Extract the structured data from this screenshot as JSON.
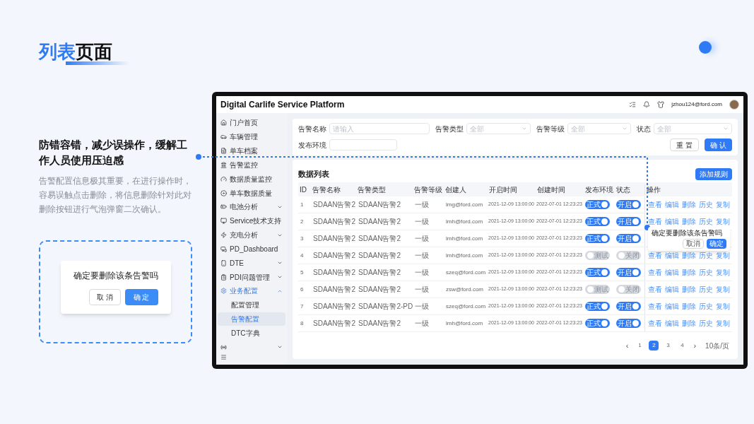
{
  "slide": {
    "title_accent": "列表",
    "title_rest": "页面",
    "heading": "防错容错，减少误操作，缓解工作人员使用压迫感",
    "paragraph": "告警配置信息极其重要，在进行操作时，容易误触点击删除，将信息删除针对此对删除按钮进行气泡弹窗二次确认。",
    "example": {
      "question": "确定要删除该条告警吗",
      "cancel": "取 消",
      "confirm": "确 定"
    }
  },
  "app": {
    "title": "Digital Carlife Service Platform",
    "user": "jzhou124@ford.com",
    "sidebar": [
      {
        "label": "门户首页",
        "selected": false
      },
      {
        "label": "车辆管理",
        "selected": false
      },
      {
        "label": "单车档案",
        "selected": false
      },
      {
        "label": "告警监控",
        "selected": false
      },
      {
        "label": "数据质量监控",
        "selected": false
      },
      {
        "label": "单车数据质量",
        "selected": false
      },
      {
        "label": "电池分析",
        "selected": false,
        "expanded": false
      },
      {
        "label": "Service技术支持",
        "selected": false,
        "expanded": false
      },
      {
        "label": "充电分析",
        "selected": false,
        "expanded": false
      },
      {
        "label": "PD_Dashboard",
        "selected": false
      },
      {
        "label": "DTE",
        "selected": false,
        "expanded": false
      },
      {
        "label": "PDI问题管理",
        "selected": false,
        "expanded": false
      },
      {
        "label": "业务配置",
        "selected": true,
        "expanded": true,
        "children": [
          {
            "label": "配置管理",
            "selected": false
          },
          {
            "label": "告警配置",
            "selected": true
          },
          {
            "label": "DTC字典",
            "selected": false
          }
        ]
      },
      {
        "selected": false,
        "expanded": false
      }
    ],
    "filters": [
      {
        "label": "告警名称",
        "kind": "input",
        "placeholder": "请输入"
      },
      {
        "label": "告警类型",
        "kind": "select",
        "placeholder": "全部"
      },
      {
        "label": "告警等级",
        "kind": "select",
        "placeholder": "全部"
      },
      {
        "label": "状态",
        "kind": "select",
        "placeholder": "全部"
      },
      {
        "label": "发布环境",
        "kind": "input"
      }
    ],
    "reset": "重 置",
    "submit": "确 认",
    "list_title": "数据列表",
    "add": "添加规则",
    "columns": [
      "ID",
      "告警名称",
      "告警类型",
      "告警等级",
      "创建人",
      "开启时间",
      "创建时间",
      "发布环境",
      "状态",
      "操作"
    ],
    "rows": [
      {
        "id": "1",
        "name": "SDAAN告警2",
        "type": "SDAAN告警2",
        "level": "一级",
        "creator": "lmg@ford.com",
        "start": "2021-12-09 13:00:00",
        "created": "2022-07-01 12:23:23",
        "env": {
          "label": "正式",
          "on": true
        },
        "status": {
          "label": "开启",
          "on": true
        },
        "actions": [
          "查看",
          "编辑",
          "删除",
          "历史",
          "复制"
        ]
      },
      {
        "id": "2",
        "name": "SDAAN告警2",
        "type": "SDAAN告警2",
        "level": "一级",
        "creator": "lmh@ford.com",
        "start": "2021-12-09 13:00:00",
        "created": "2022-07-01 12:23:23",
        "env": {
          "label": "正式",
          "on": true
        },
        "status": {
          "label": "开启",
          "on": true
        },
        "actions": [
          "查看",
          "编辑",
          "删除",
          "历史",
          "复制"
        ]
      },
      {
        "id": "3",
        "name": "SDAAN告警2",
        "type": "SDAAN告警2",
        "level": "一级",
        "creator": "lmh@ford.com",
        "start": "2021-12-09 13:00:00",
        "created": "2022-07-01 12:23:23",
        "env": {
          "label": "正式",
          "on": true
        },
        "status": {
          "label": "开启",
          "on": true
        },
        "confirm": {
          "question": "确定要删除该条告警吗",
          "cancel": "取消",
          "confirm": "确定"
        }
      },
      {
        "id": "4",
        "name": "SDAAN告警2",
        "type": "SDAAN告警2",
        "level": "一级",
        "creator": "lmh@ford.com",
        "start": "2021-12-09 13:00:00",
        "created": "2022-07-01 12:23:23",
        "env": {
          "label": "测试",
          "on": false
        },
        "status": {
          "label": "关闭",
          "on": false
        },
        "actions": [
          "查看",
          "编辑",
          "删除",
          "历史",
          "复制"
        ]
      },
      {
        "id": "5",
        "name": "SDAAN告警2",
        "type": "SDAAN告警2",
        "level": "一级",
        "creator": "szeq@ford.com",
        "start": "2021-12-09 13:00:00",
        "created": "2022-07-01 12:23:23",
        "env": {
          "label": "正式",
          "on": true
        },
        "status": {
          "label": "开启",
          "on": true
        },
        "actions": [
          "查看",
          "编辑",
          "删除",
          "历史",
          "复制"
        ]
      },
      {
        "id": "6",
        "name": "SDAAN告警2",
        "type": "SDAAN告警2",
        "level": "一级",
        "creator": "zsw@ford.com",
        "start": "2021-12-09 13:00:00",
        "created": "2022-07-01 12:23:23",
        "env": {
          "label": "测试",
          "on": false
        },
        "status": {
          "label": "关闭",
          "on": false
        },
        "actions": [
          "查看",
          "编辑",
          "删除",
          "历史",
          "复制"
        ]
      },
      {
        "id": "7",
        "name": "SDAAN告警2",
        "type": "SDAAN告警2-PD",
        "level": "一级",
        "creator": "szeq@ford.com",
        "start": "2021-12-09 13:00:00",
        "created": "2022-07-01 12:23:23",
        "env": {
          "label": "正式",
          "on": true
        },
        "status": {
          "label": "开启",
          "on": true
        },
        "actions": [
          "查看",
          "编辑",
          "删除",
          "历史",
          "复制"
        ]
      },
      {
        "id": "8",
        "name": "SDAAN告警2",
        "type": "SDAAN告警2",
        "level": "一级",
        "creator": "lmh@ford.com",
        "start": "2021-12-09 13:00:00",
        "created": "2022-07-01 12:23:23",
        "env": {
          "label": "正式",
          "on": true
        },
        "status": {
          "label": "开启",
          "on": true
        },
        "actions": [
          "查看",
          "编辑",
          "删除",
          "历史",
          "复制"
        ]
      }
    ],
    "pagination": {
      "prev": "‹",
      "next": "›",
      "pages": [
        {
          "label": "1",
          "selected": false
        },
        {
          "label": "2",
          "selected": true
        },
        {
          "label": "3",
          "selected": false
        },
        {
          "label": "4",
          "selected": false
        }
      ],
      "size": "10条/页"
    }
  }
}
